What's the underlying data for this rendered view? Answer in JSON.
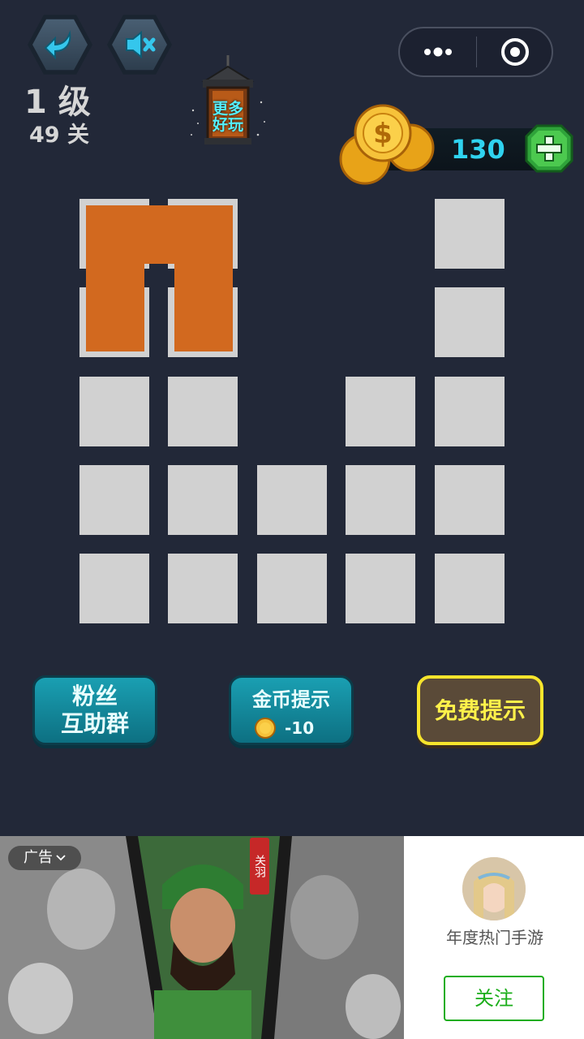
{
  "top_bar": {
    "back_icon": "back-arrow-icon",
    "mute_icon": "speaker-muted-icon",
    "level_label": "1 级",
    "stage_label": "49 关",
    "more_games_label_line1": "更多",
    "more_games_label_line2": "好玩",
    "menu_icon": "more-dots-icon",
    "close_icon": "target-circle-icon"
  },
  "coins": {
    "value": "130",
    "coin_icon": "gold-coin-icon",
    "add_icon": "green-plus-gem-icon"
  },
  "actions": {
    "fans_line1": "粉丝",
    "fans_line2": "互助群",
    "coin_hint_label": "金币提示",
    "coin_hint_cost": "-10",
    "free_hint_label": "免费提示"
  },
  "ad": {
    "tag_label": "广告",
    "tag_icon": "chevron-down-icon",
    "character_badge": "关羽",
    "app_title": "年度热门手游",
    "follow_label": "关注"
  },
  "colors": {
    "background": "#222838",
    "cell": "#d1d1d1",
    "piece": "#d2691f",
    "coin_text": "#2fd3f0",
    "free_hint_border": "#f7e52c"
  }
}
